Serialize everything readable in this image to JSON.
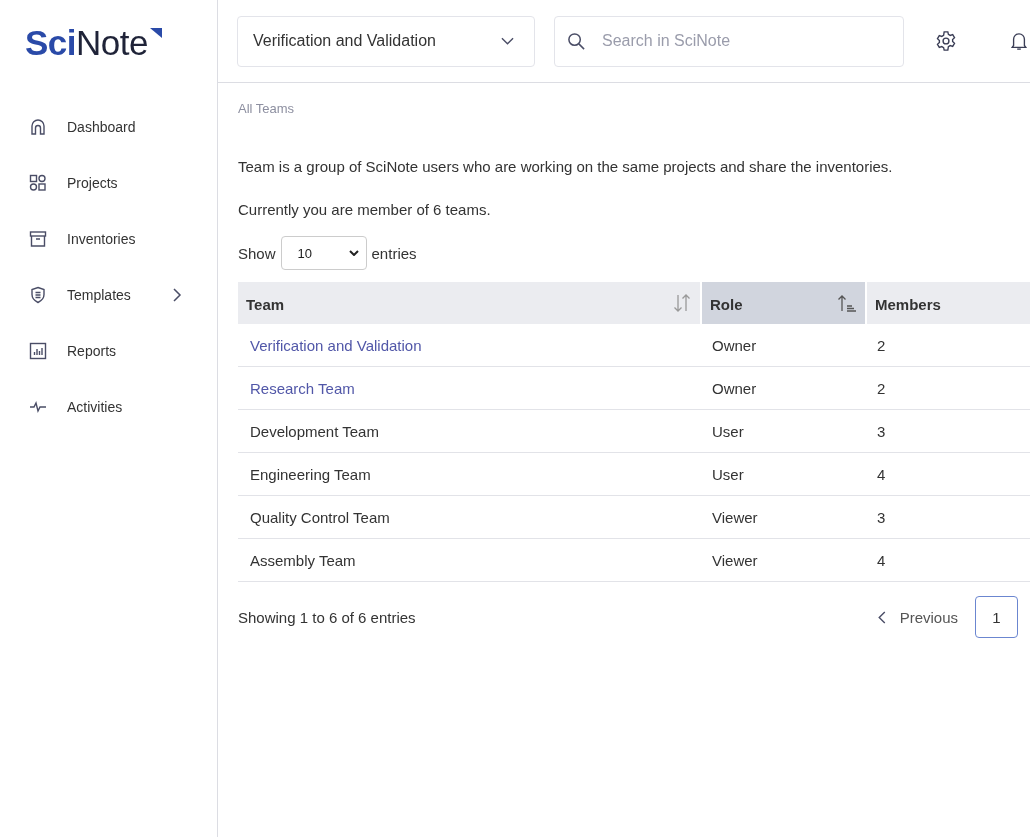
{
  "logo": "**Sci**Note",
  "sidebar": {
    "items": [
      {
        "label": "Dashboard",
        "kind": "home",
        "expandable": false
      },
      {
        "label": "Projects",
        "kind": "grid",
        "expandable": false
      },
      {
        "label": "Inventories",
        "kind": "archive",
        "expandable": false
      },
      {
        "label": "Templates",
        "kind": "shield",
        "expandable": true
      },
      {
        "label": "Reports",
        "kind": "chart",
        "expandable": false
      },
      {
        "label": "Activities",
        "kind": "pulse",
        "expandable": false
      }
    ]
  },
  "header": {
    "team_select": "Verification and Validation",
    "search": {
      "placeholder": "Search in SciNote"
    }
  },
  "breadcrumb": "All Teams",
  "intro": "Team is a group of SciNote users who are working on the same projects and share the inventories.",
  "member_count": "Currently you are member of 6 teams.",
  "length_menu": {
    "prefix": "Show",
    "value": "10",
    "suffix": "entries"
  },
  "table": {
    "columns": [
      {
        "label": "Team",
        "sorted": false
      },
      {
        "label": "Role",
        "sorted": true
      },
      {
        "label": "Members",
        "sorted": false
      }
    ],
    "rows": [
      {
        "kind": "link",
        "team": "Verification and Validation",
        "role": "Owner",
        "members": "2"
      },
      {
        "kind": "link",
        "team": "Research Team",
        "role": "Owner",
        "members": "2"
      },
      {
        "kind": "text",
        "team": "Development Team",
        "role": "User",
        "members": "3"
      },
      {
        "kind": "text",
        "team": "Engineering Team",
        "role": "User",
        "members": "4"
      },
      {
        "kind": "text",
        "team": "Quality Control Team",
        "role": "Viewer",
        "members": "3"
      },
      {
        "kind": "text",
        "team": "Assembly Team",
        "role": "Viewer",
        "members": "4"
      }
    ]
  },
  "info": "Showing 1 to 6 of 6 entries",
  "pagination": {
    "previous": "Previous",
    "pages": [
      {
        "label": "1",
        "selected": true
      }
    ]
  }
}
